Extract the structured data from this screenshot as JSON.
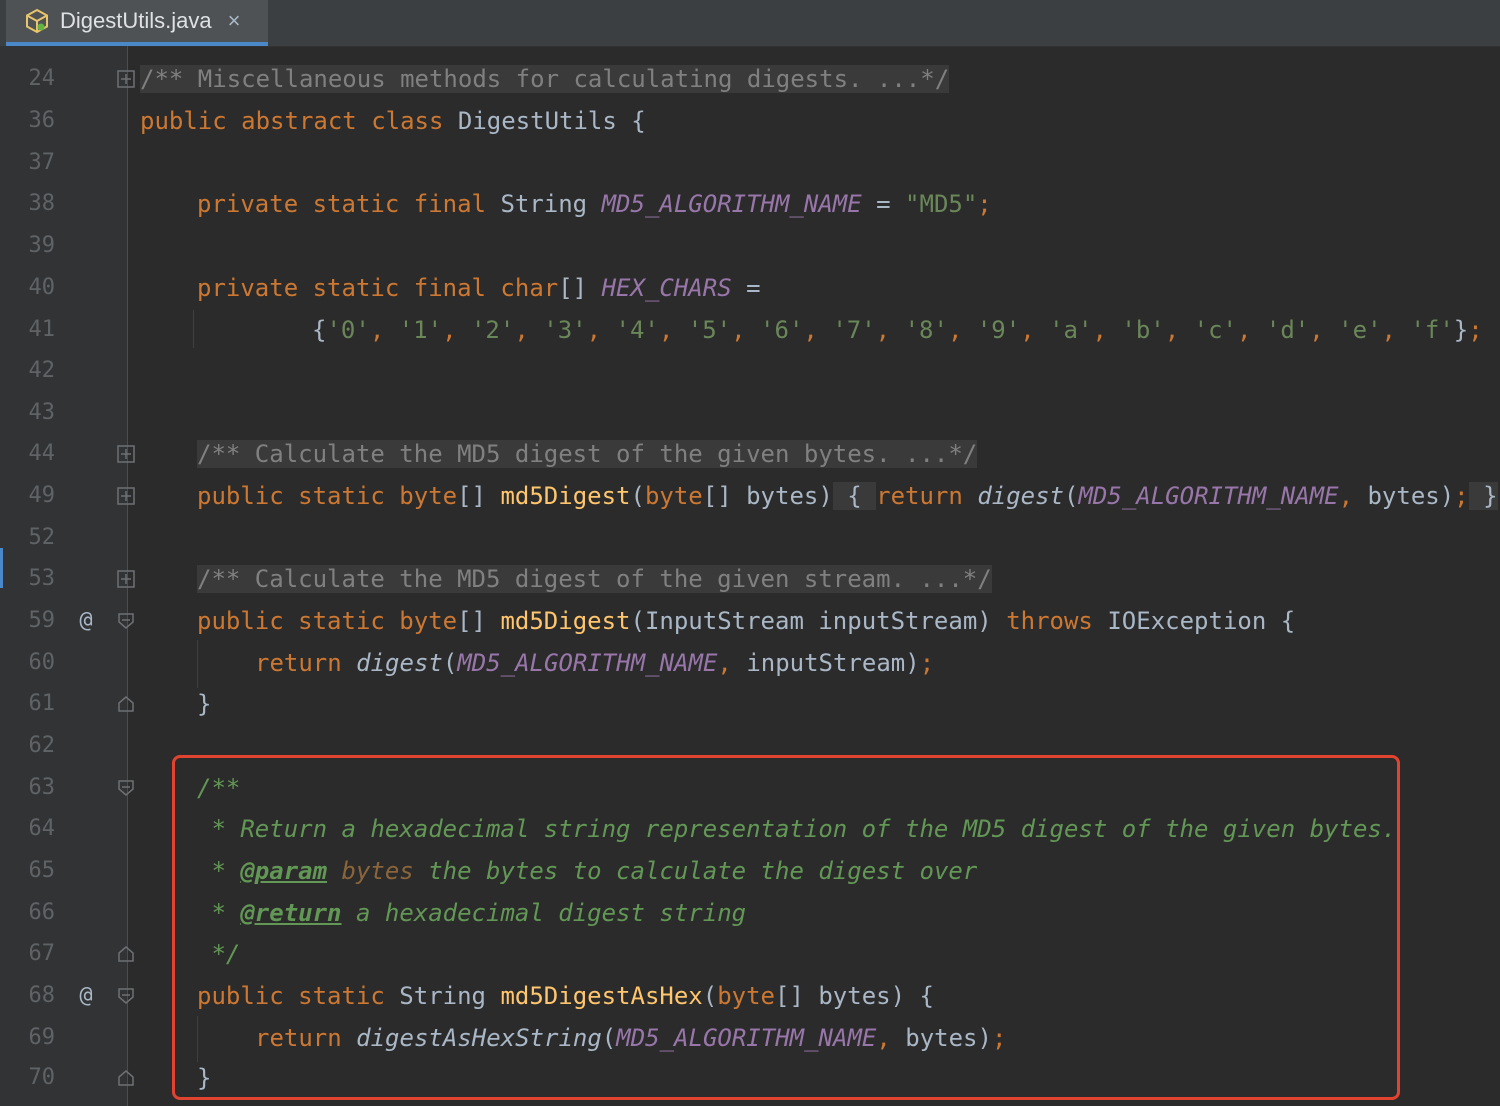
{
  "tab": {
    "label": "DigestUtils.java",
    "close": "×",
    "icon": "java-class-icon"
  },
  "lines": {
    "l24": {
      "num": "24",
      "c1": "/** Miscellaneous methods for calculating digests. ...*/"
    },
    "l36": {
      "num": "36",
      "k1": "public abstract class ",
      "t1": "DigestUtils {"
    },
    "l37": {
      "num": "37"
    },
    "l38": {
      "num": "38",
      "k1": "private static final ",
      "t1": "String ",
      "c1": "MD5_ALGORITHM_NAME",
      "t2": " = ",
      "s1": "\"MD5\"",
      "k2": ";"
    },
    "l39": {
      "num": "39"
    },
    "l40": {
      "num": "40",
      "k1": "private static final char",
      "t1": "[] ",
      "c1": "HEX_CHARS",
      "t2": " ="
    },
    "l41": {
      "num": "41",
      "t1": "{",
      "s1": "'0'",
      "s2": "'1'",
      "s3": "'2'",
      "s4": "'3'",
      "s5": "'4'",
      "s6": "'5'",
      "s7": "'6'",
      "s8": "'7'",
      "s9": "'8'",
      "s10": "'9'",
      "s11": "'a'",
      "s12": "'b'",
      "s13": "'c'",
      "s14": "'d'",
      "s15": "'e'",
      "s16": "'f'",
      "sep": ", ",
      "t2": "}",
      "k1": ";"
    },
    "l42": {
      "num": "42"
    },
    "l43": {
      "num": "43"
    },
    "l44": {
      "num": "44",
      "c1": "/** Calculate the MD5 digest of the given bytes. ...*/"
    },
    "l49": {
      "num": "49",
      "k1": "public static byte",
      "t1": "[] ",
      "f1": "md5Digest",
      "t2": "(",
      "k2": "byte",
      "t3": "[] bytes)",
      "d1": " { ",
      "k3": "return ",
      "i1": "digest",
      "t4": "(",
      "c1": "MD5_ALGORITHM_NAME",
      "k4": ", ",
      "t5": "bytes)",
      "k5": ";",
      "d2": " }"
    },
    "l52": {
      "num": "52"
    },
    "l53": {
      "num": "53",
      "c1": "/** Calculate the MD5 digest of the given stream. ...*/"
    },
    "l59": {
      "num": "59",
      "at": "@",
      "k1": "public static byte",
      "t1": "[] ",
      "f1": "md5Digest",
      "t2": "(InputStream inputStream) ",
      "k2": "throws ",
      "t3": "IOException {"
    },
    "l60": {
      "num": "60",
      "k1": "return ",
      "i1": "digest",
      "t1": "(",
      "c1": "MD5_ALGORITHM_NAME",
      "k2": ", ",
      "t2": "inputStream)",
      "k3": ";"
    },
    "l61": {
      "num": "61",
      "t1": "}"
    },
    "l62": {
      "num": "62"
    },
    "l63": {
      "num": "63",
      "d1": "/**"
    },
    "l64": {
      "num": "64",
      "d1": " * Return a hexadecimal string representation of the MD5 digest of the given bytes."
    },
    "l65": {
      "num": "65",
      "d1": " * ",
      "g1": "@param",
      "p1": " bytes",
      "d2": " the bytes to calculate the digest over"
    },
    "l66": {
      "num": "66",
      "d1": " * ",
      "g1": "@return",
      "d2": " a hexadecimal digest string"
    },
    "l67": {
      "num": "67",
      "d1": " */"
    },
    "l68": {
      "num": "68",
      "at": "@",
      "k1": "public static ",
      "t1": "String ",
      "f1": "md5DigestAsHex",
      "t2": "(",
      "k2": "byte",
      "t3": "[] bytes) {"
    },
    "l69": {
      "num": "69",
      "k1": "return ",
      "i1": "digestAsHexString",
      "t1": "(",
      "c1": "MD5_ALGORITHM_NAME",
      "k2": ", ",
      "t2": "bytes)",
      "k3": ";"
    },
    "l70": {
      "num": "70",
      "t1": "}"
    }
  },
  "colors": {
    "background": "#2b2b2b",
    "keyword": "#cc7832",
    "constant": "#9876aa",
    "string": "#6a8759",
    "method": "#ffc66d",
    "javadoc": "#629755",
    "highlight_border": "#e0432f"
  }
}
